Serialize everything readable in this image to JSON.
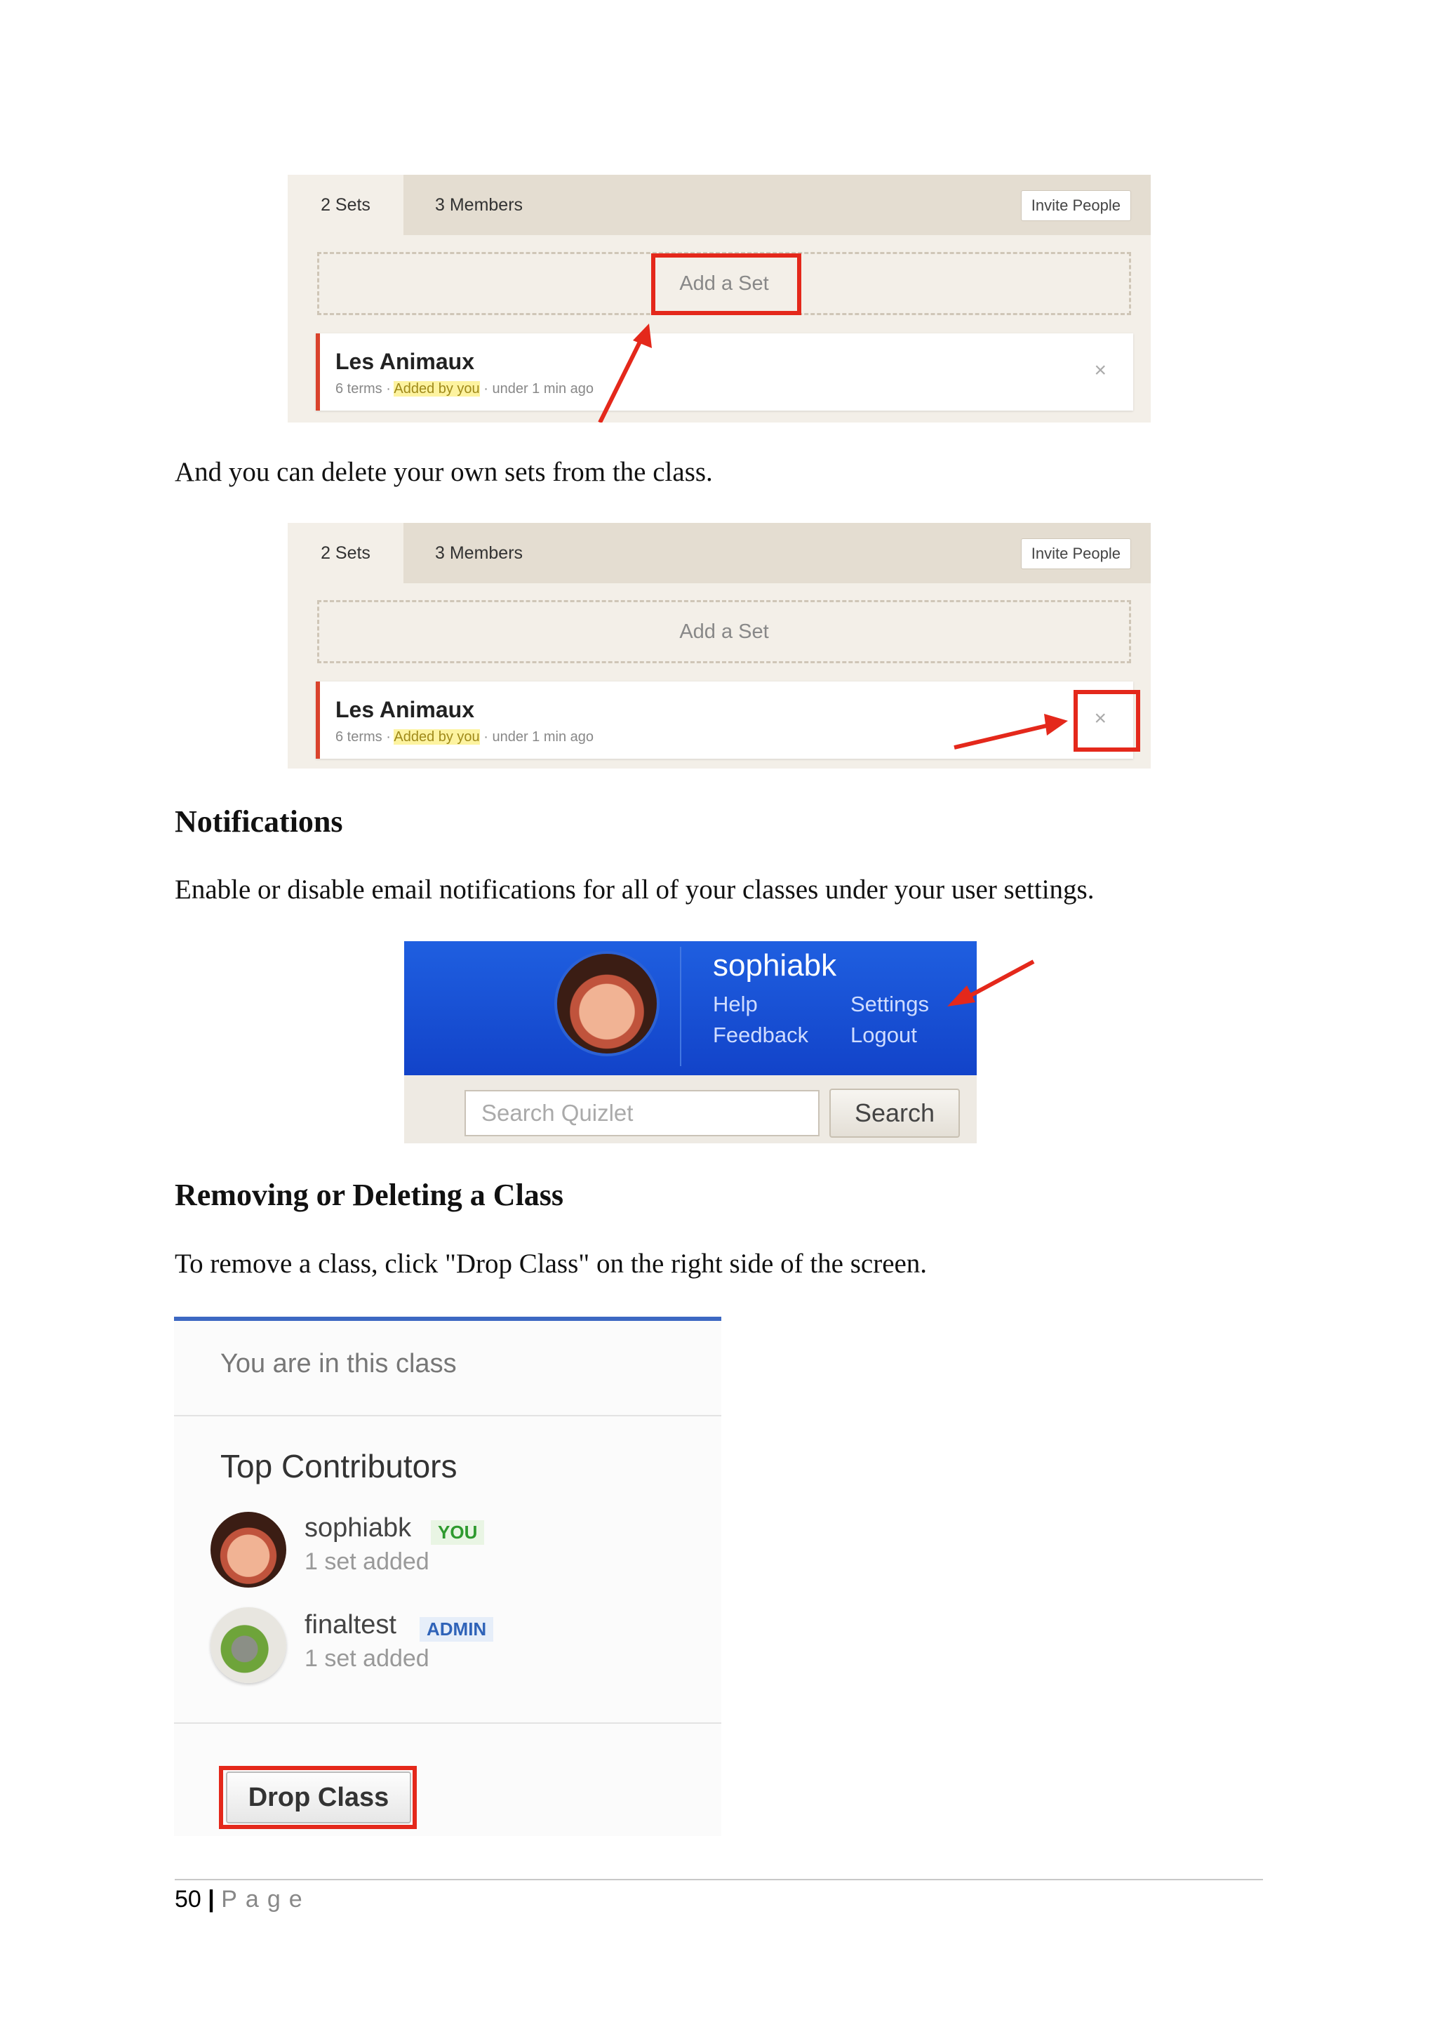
{
  "screenshot_add": {
    "tab_sets": "2 Sets",
    "tab_members": "3 Members",
    "invite_button": "Invite People",
    "add_set": "Add a Set",
    "set_title": "Les Animaux",
    "set_terms": "6 terms · ",
    "set_added": "Added by you",
    "set_time": " · under 1 min ago",
    "remove_glyph": "×"
  },
  "screenshot_delete": {
    "tab_sets": "2 Sets",
    "tab_members": "3 Members",
    "invite_button": "Invite People",
    "add_set": "Add a Set",
    "set_title": "Les Animaux",
    "set_terms": "6 terms · ",
    "set_added": "Added by you",
    "set_time": " · under 1 min ago",
    "remove_glyph": "×"
  },
  "text": {
    "delete_sentence": "And you can delete your own sets from the class.",
    "notifications_heading": "Notifications",
    "notifications_body": "Enable or disable email notifications for all of your classes under your user settings.",
    "removing_heading": "Removing or Deleting a Class",
    "removing_body": "To remove a class, click \"Drop Class\" on the right side of the screen."
  },
  "quizlet_header": {
    "username": "sophiabk",
    "help": "Help",
    "settings": "Settings",
    "feedback": "Feedback",
    "logout": "Logout",
    "search_placeholder": "Search Quizlet",
    "search_button": "Search"
  },
  "class_panel": {
    "status": "You are in this class",
    "contributors_heading": "Top Contributors",
    "contributors": [
      {
        "name": "sophiabk",
        "badge": "YOU",
        "sub": "1 set added"
      },
      {
        "name": "finaltest",
        "badge": "ADMIN",
        "sub": "1 set added"
      }
    ],
    "drop_button": "Drop Class"
  },
  "footer": {
    "page_number": "50",
    "separator": "|",
    "page_word": "Page"
  },
  "colors": {
    "annotation_red": "#e4281b",
    "quizlet_blue": "#1f5fe0",
    "badge_you": "#2e9a2e",
    "badge_admin": "#2f63b8"
  }
}
